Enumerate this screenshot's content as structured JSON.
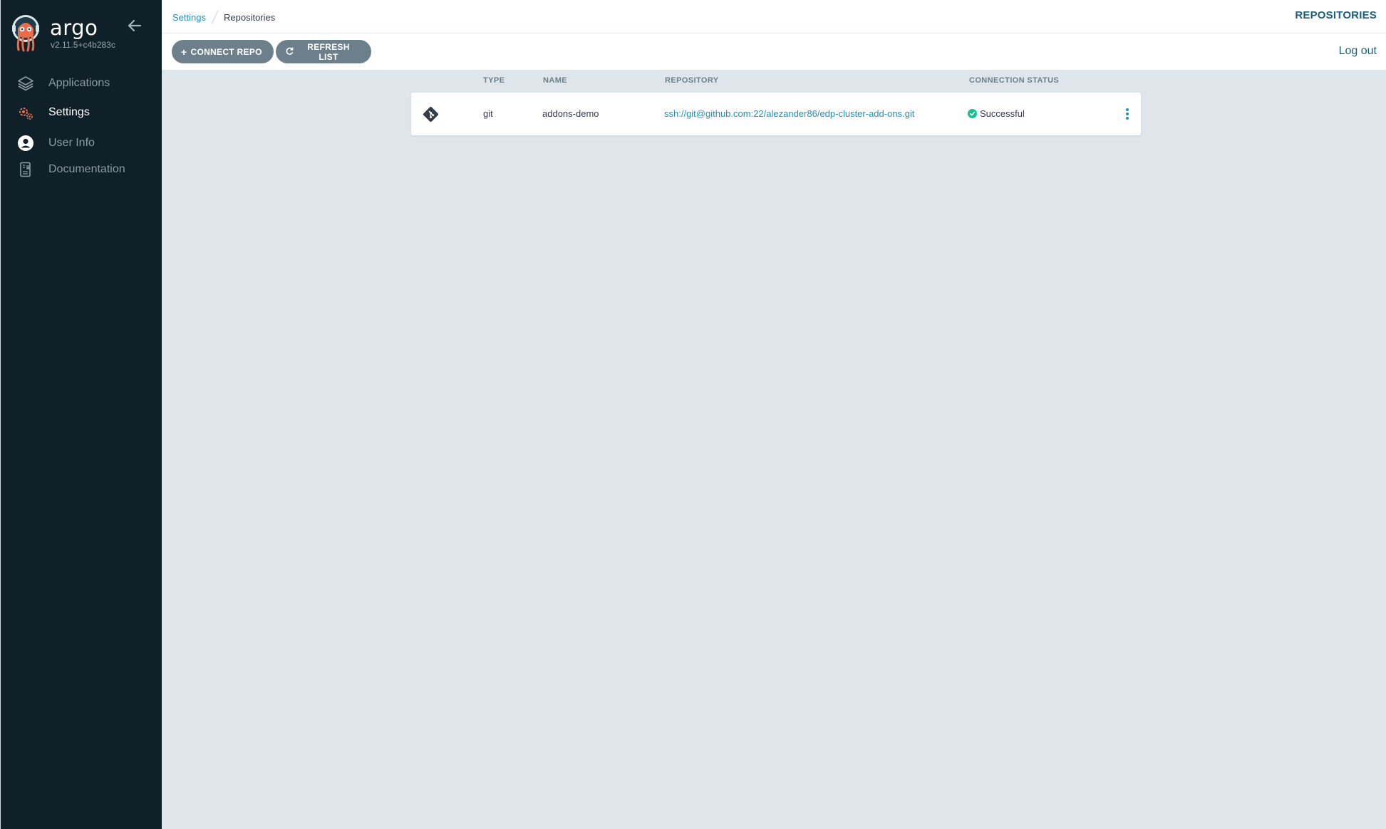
{
  "sidebar": {
    "brand": "argo",
    "version": "v2.11.5+c4b283c",
    "items": [
      {
        "label": "Applications",
        "icon": "layers-icon",
        "active": false
      },
      {
        "label": "Settings",
        "icon": "gears-icon",
        "active": true
      },
      {
        "label": "User Info",
        "icon": "user-circle-icon",
        "active": false
      },
      {
        "label": "Documentation",
        "icon": "book-icon",
        "active": false
      }
    ]
  },
  "header": {
    "breadcrumb": [
      "Settings",
      "Repositories"
    ],
    "title": "REPOSITORIES"
  },
  "toolbar": {
    "connect_label": "CONNECT REPO",
    "refresh_label": "REFRESH LIST",
    "logout_label": "Log out"
  },
  "table": {
    "columns": [
      "TYPE",
      "NAME",
      "REPOSITORY",
      "CONNECTION STATUS"
    ],
    "rows": [
      {
        "type": "git",
        "name": "addons-demo",
        "repository": "ssh://git@github.com:22/alezander86/edp-cluster-add-ons.git",
        "status": "Successful"
      }
    ]
  },
  "colors": {
    "sidebar_bg": "#0f2028",
    "accent": "#1f93b7",
    "button_bg": "#6d7f8b",
    "success": "#18be94",
    "content_bg": "#dee6eb",
    "logo_orange": "#e96d4c"
  }
}
